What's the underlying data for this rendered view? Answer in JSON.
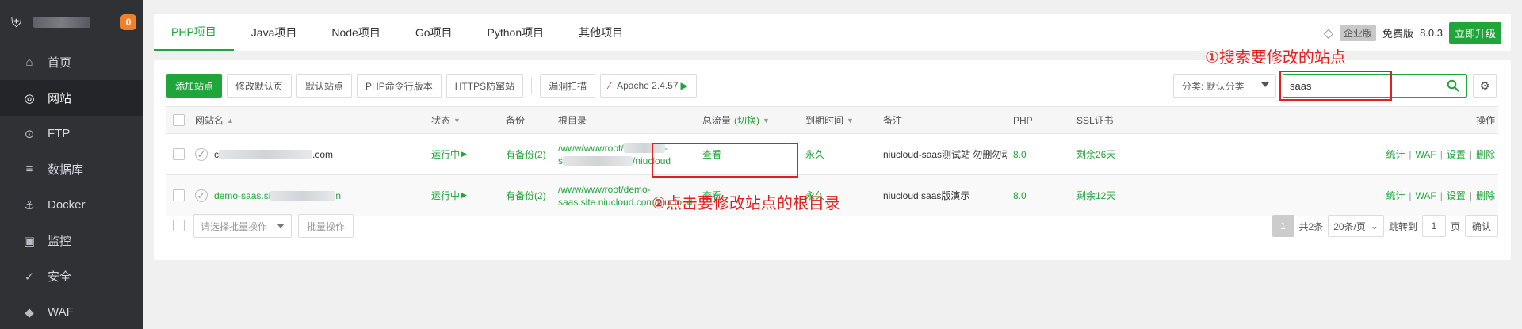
{
  "sidebar": {
    "badge": "0",
    "items": [
      {
        "label": "首页",
        "icon": "home-icon"
      },
      {
        "label": "网站",
        "icon": "globe-icon",
        "active": true
      },
      {
        "label": "FTP",
        "icon": "ftp-icon"
      },
      {
        "label": "数据库",
        "icon": "database-icon"
      },
      {
        "label": "Docker",
        "icon": "docker-icon"
      },
      {
        "label": "监控",
        "icon": "monitor-icon"
      },
      {
        "label": "安全",
        "icon": "shield-check-icon"
      },
      {
        "label": "WAF",
        "icon": "waf-shield-icon"
      }
    ]
  },
  "tabs": [
    "PHP项目",
    "Java项目",
    "Node项目",
    "Go项目",
    "Python项目",
    "其他项目"
  ],
  "topRight": {
    "edition": "企业版",
    "free": "免费版",
    "version": "8.0.3",
    "upgrade": "立即升级"
  },
  "toolbar": {
    "add_site": "添加站点",
    "modify_default_page": "修改默认页",
    "default_site": "默认站点",
    "php_cli_version": "PHP命令行版本",
    "https_guard": "HTTPS防窜站",
    "vuln_scan": "漏洞扫描",
    "apache": "Apache 2.4.57"
  },
  "category": "分类: 默认分类",
  "search": {
    "value": "saas"
  },
  "annotations": {
    "search": "①搜索要修改的站点",
    "root_dir": "②点击要修改站点的根目录"
  },
  "table": {
    "headers": {
      "name": "网站名",
      "status": "状态",
      "backup": "备份",
      "root": "根目录",
      "traffic": "总流量",
      "traffic_switch": "(切换)",
      "expire": "到期时间",
      "remark": "备注",
      "php": "PHP",
      "ssl": "SSL证书",
      "ops": "操作"
    },
    "rows": [
      {
        "name_prefix": "c",
        "name_suffix": ".com",
        "status": "运行中",
        "backup": "有备份(2)",
        "root_line1": "/www/wwwroot/",
        "root_line1_tail": "-",
        "root_line2_prefix": "s",
        "root_line2_suffix": "/niucloud",
        "traffic": "查看",
        "expire": "永久",
        "remark": "niucloud-saas测试站   勿删勿动!",
        "php": "8.0",
        "ssl": "剩余26天",
        "ops": [
          "统计",
          "WAF",
          "设置",
          "删除"
        ]
      },
      {
        "name_prefix": "demo-saas.si",
        "name_suffix": "n",
        "status": "运行中",
        "backup": "有备份(2)",
        "root_line1": "/www/wwwroot/demo-",
        "root_line2": "saas.site.niucloud.com/niucloud",
        "traffic": "查看",
        "expire": "永久",
        "remark": "niucloud   saas版演示",
        "php": "8.0",
        "ssl": "剩余12天",
        "ops": [
          "统计",
          "WAF",
          "设置",
          "删除"
        ]
      }
    ]
  },
  "footer": {
    "batch_placeholder": "请选择批量操作",
    "batch_btn": "批量操作",
    "page": "1",
    "total": "共2条",
    "page_size": "20条/页",
    "jump": "跳转到",
    "jump_value": "1",
    "page_unit": "页",
    "confirm": "确认"
  }
}
